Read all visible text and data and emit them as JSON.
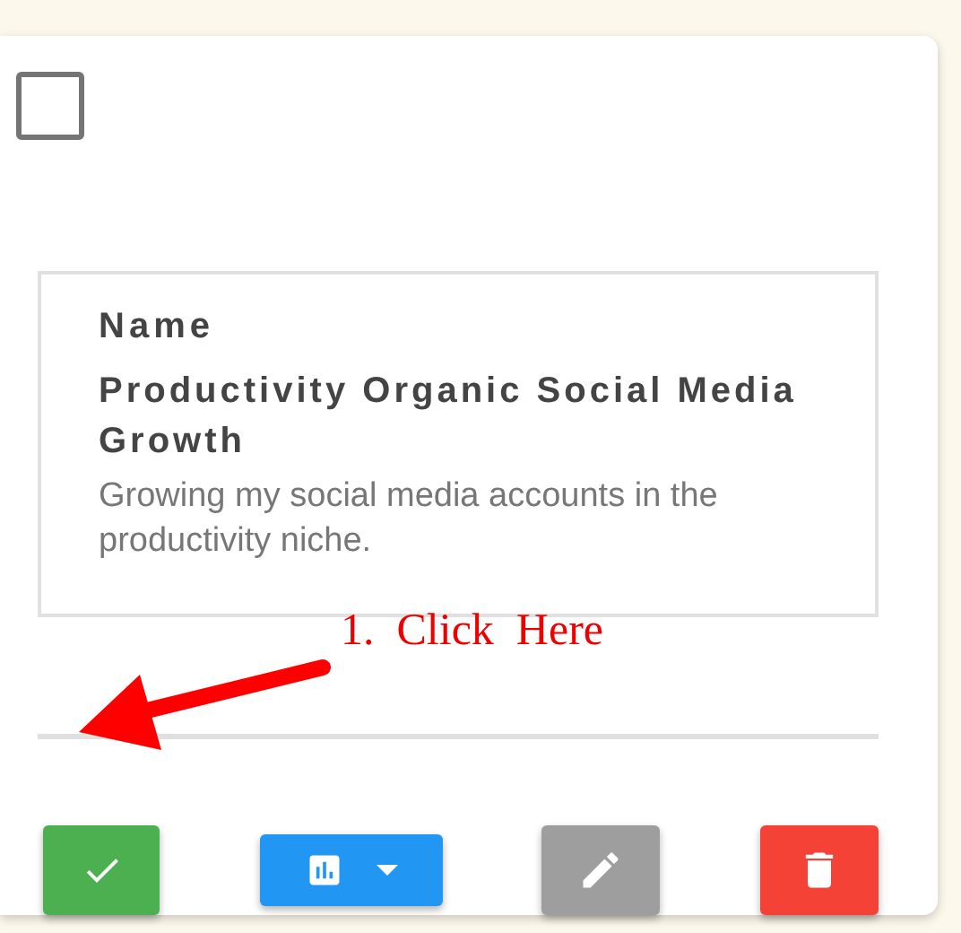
{
  "card": {
    "checkbox": {
      "checked": false
    },
    "field_label": "Name",
    "title": "Productivity Organic Social Media Growth",
    "description": "Growing my social media accounts in the productivity niche.",
    "actions": [
      {
        "kind": "complete"
      },
      {
        "kind": "stats"
      },
      {
        "kind": "edit"
      },
      {
        "kind": "delete"
      }
    ]
  },
  "annotation": {
    "text": "1.  Click  Here"
  }
}
